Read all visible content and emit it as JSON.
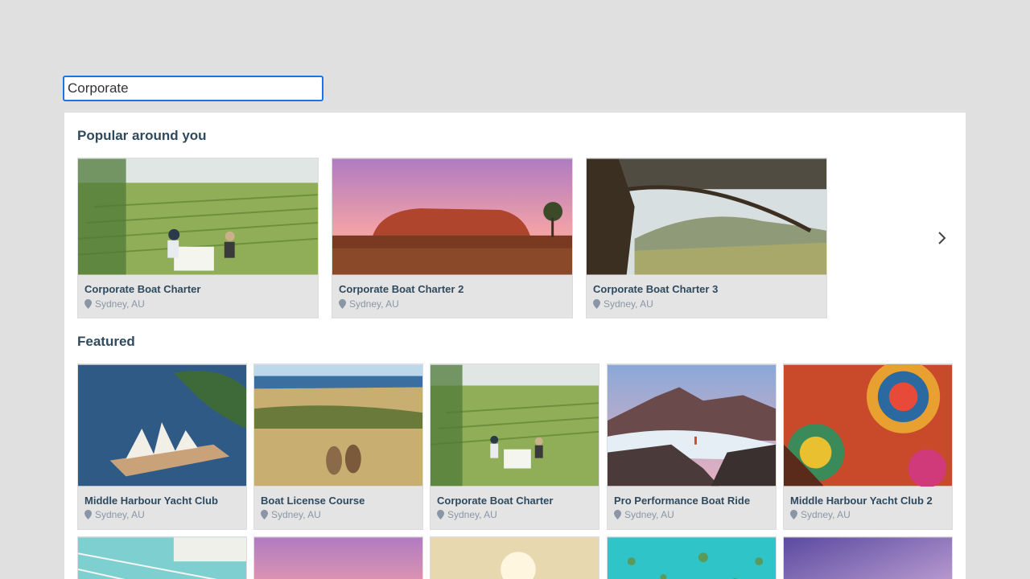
{
  "search": {
    "value": "Corporate"
  },
  "popular": {
    "title": "Popular around you",
    "items": [
      {
        "name": "Corporate Boat Charter",
        "location": "Sydney, AU",
        "image": "vineyard-picnic"
      },
      {
        "name": "Corporate Boat Charter 2",
        "location": "Sydney, AU",
        "image": "uluru-sunset"
      },
      {
        "name": "Corporate Boat Charter 3",
        "location": "Sydney, AU",
        "image": "tree-valley"
      }
    ]
  },
  "featured": {
    "title": "Featured",
    "items": [
      {
        "name": "Middle Harbour Yacht Club",
        "location": "Sydney, AU",
        "image": "opera-house"
      },
      {
        "name": "Boat License Course",
        "location": "Sydney, AU",
        "image": "kangaroos"
      },
      {
        "name": "Corporate Boat Charter",
        "location": "Sydney, AU",
        "image": "vineyard-picnic"
      },
      {
        "name": "Pro Performance Boat Ride",
        "location": "Sydney, AU",
        "image": "mountain-clouds"
      },
      {
        "name": "Middle Harbour Yacht Club 2",
        "location": "Sydney, AU",
        "image": "aboriginal-art"
      }
    ],
    "partial_row_images": [
      "pool",
      "pink-sky",
      "sunset-hills",
      "turquoise-reef",
      "purple-sky"
    ]
  },
  "icons": {
    "pin": "location-pin-icon",
    "next": "chevron-right-icon"
  }
}
